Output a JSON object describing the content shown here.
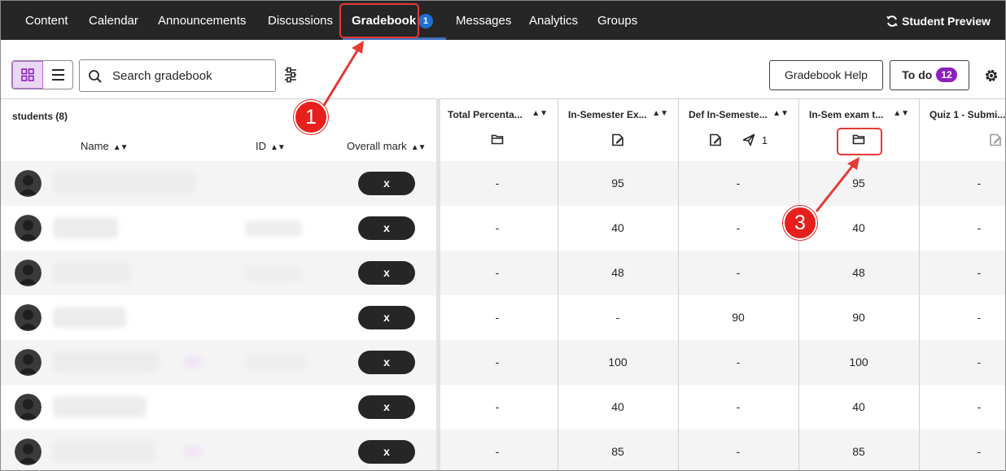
{
  "nav": {
    "items": [
      "Content",
      "Calendar",
      "Announcements",
      "Discussions",
      "Gradebook",
      "Messages",
      "Analytics",
      "Groups"
    ],
    "active": "Gradebook",
    "gradebook_badge": "1",
    "student_preview": "Student Preview"
  },
  "toolbar": {
    "search_placeholder": "Search gradebook",
    "help_label": "Gradebook Help",
    "todo_label": "To do",
    "todo_count": "12"
  },
  "grid": {
    "students_title": "students (8)",
    "col_name": "Name",
    "col_id": "ID",
    "col_overall": "Overall mark",
    "columns": [
      {
        "title": "Total Percenta...",
        "icon": "folder-icon"
      },
      {
        "title": "In-Semester Ex...",
        "icon": "assignment-icon"
      },
      {
        "title": "Def In-Semeste...",
        "icon": "assignment-icon",
        "sent_count": "1"
      },
      {
        "title": "In-Sem exam t...",
        "icon": "folder-icon"
      },
      {
        "title": "Quiz 1 - Submi...",
        "icon": "assignment-icon"
      }
    ],
    "rows": [
      {
        "overall": "x",
        "cells": [
          "-",
          "95",
          "-",
          "95",
          "-"
        ]
      },
      {
        "overall": "x",
        "cells": [
          "-",
          "40",
          "-",
          "40",
          "-"
        ]
      },
      {
        "overall": "x",
        "cells": [
          "-",
          "48",
          "-",
          "48",
          "-"
        ]
      },
      {
        "overall": "x",
        "cells": [
          "-",
          "-",
          "90",
          "90",
          "-"
        ]
      },
      {
        "overall": "x",
        "cells": [
          "-",
          "100",
          "-",
          "100",
          "-"
        ]
      },
      {
        "overall": "x",
        "cells": [
          "-",
          "40",
          "-",
          "40",
          "-"
        ]
      },
      {
        "overall": "x",
        "cells": [
          "-",
          "85",
          "-",
          "85",
          "-"
        ]
      }
    ]
  },
  "annotations": {
    "step1": "1",
    "step3": "3",
    "color": "#e53935"
  },
  "colors": {
    "nav_bg": "#262626",
    "accent_purple": "#8e1fbd",
    "badge_blue": "#1f6fd4"
  }
}
